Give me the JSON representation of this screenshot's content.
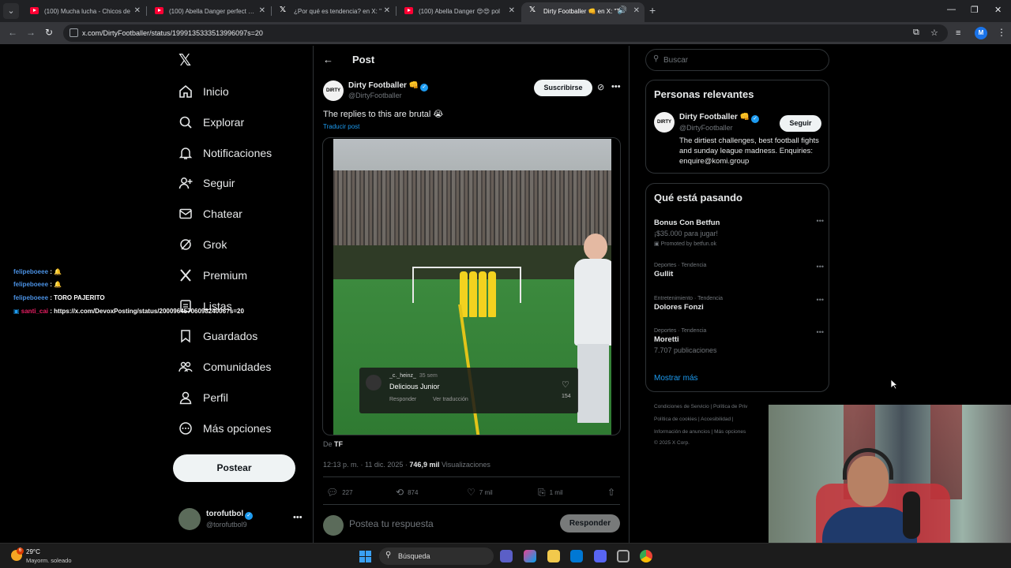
{
  "browser": {
    "tabs": [
      {
        "title": "(100) Mucha lucha - Chicos de",
        "favicon": "youtube-icon",
        "active": false
      },
      {
        "title": "(100) Abella Danger perfect ass",
        "favicon": "youtube-icon",
        "active": false
      },
      {
        "title": "¿Por qué es tendencia? en X: \"",
        "favicon": "x-icon",
        "active": false
      },
      {
        "title": "(100) Abella Danger 😍😍 pol",
        "favicon": "youtube-icon",
        "active": false
      },
      {
        "title": "Dirty Footballer 👊 en X: \"T",
        "favicon": "x-icon",
        "active": true
      }
    ],
    "url": "x.com/DirtyFootballer/status/1999135333513996097s=20",
    "profile_initial": "M"
  },
  "x": {
    "logo": "𝕏",
    "nav": [
      {
        "label": "Inicio",
        "icon": "home-icon"
      },
      {
        "label": "Explorar",
        "icon": "search-icon"
      },
      {
        "label": "Notificaciones",
        "icon": "bell-icon"
      },
      {
        "label": "Seguir",
        "icon": "person-add-icon"
      },
      {
        "label": "Chatear",
        "icon": "mail-icon"
      },
      {
        "label": "Grok",
        "icon": "grok-icon"
      },
      {
        "label": "Premium",
        "icon": "x-icon"
      },
      {
        "label": "Listas",
        "icon": "list-icon"
      },
      {
        "label": "Guardados",
        "icon": "bookmark-icon"
      },
      {
        "label": "Comunidades",
        "icon": "communities-icon"
      },
      {
        "label": "Perfil",
        "icon": "profile-icon"
      },
      {
        "label": "Más opciones",
        "icon": "more-icon"
      }
    ],
    "post_button": "Postear",
    "me": {
      "name": "torofutbol",
      "handle": "@torofutbol9"
    }
  },
  "chat": [
    {
      "user": "felipeboeee",
      "message": "🔔",
      "user_color": "#4a90e2"
    },
    {
      "user": "felipeboeee",
      "message": "🔔",
      "user_color": "#4a90e2"
    },
    {
      "user": "felipeboeee",
      "message": "TORO PAJERITO",
      "user_color": "#4a90e2"
    },
    {
      "user": "santi_cai",
      "message": "https://x.com/DevoxPosting/status/2000964570609824006?s=20",
      "user_color": "#e91e63"
    }
  ],
  "post": {
    "header": "Post",
    "author_name": "Dirty Footballer",
    "author_emoji": "👊",
    "author_handle": "@DirtyFootballer",
    "avatar_text": "DIRTY",
    "subscribe": "Suscribirse",
    "text": "The replies to this are brutal 😭",
    "translate": "Traducir post",
    "video_comment": {
      "user": "_c._heinz_",
      "time": "35 sem",
      "text": "Delicious Junior",
      "reply": "Responder",
      "translate": "Ver traducción",
      "likes": "154"
    },
    "from_prefix": "De",
    "from_source": "TF",
    "timestamp": "12:13 p. m. · 11 dic. 2025 ·",
    "views_count": "746,9 mil",
    "views_label": "Visualizaciones",
    "actions": [
      {
        "icon": "reply-icon",
        "count": "227"
      },
      {
        "icon": "retweet-icon",
        "count": "874"
      },
      {
        "icon": "heart-icon",
        "count": "7 mil"
      },
      {
        "icon": "bookmark-icon",
        "count": "1 mil"
      },
      {
        "icon": "share-icon",
        "count": ""
      }
    ],
    "reply_placeholder": "Postea tu respuesta",
    "reply_button": "Responder"
  },
  "sidebar": {
    "search_placeholder": "Buscar",
    "relevant": {
      "title": "Personas relevantes",
      "name": "Dirty Footballer",
      "emoji": "👊",
      "handle": "@DirtyFootballer",
      "follow": "Seguir",
      "bio": "The dirtiest challenges, best football fights and sunday league madness. Enquiries: enquire@komi.group"
    },
    "trending": {
      "title": "Qué está pasando",
      "items": [
        {
          "meta": "",
          "name": "Bonus Con Betfun",
          "sub": "¡$35.000 para jugar!",
          "promo": "Promoted by betfun.ok"
        },
        {
          "meta": "Deportes · Tendencia",
          "name": "Gullit",
          "sub": "",
          "promo": ""
        },
        {
          "meta": "Entretenimiento · Tendencia",
          "name": "Dolores Fonzi",
          "sub": "",
          "promo": ""
        },
        {
          "meta": "Deportes · Tendencia",
          "name": "Moretti",
          "sub": "7.707 publicaciones",
          "promo": ""
        }
      ],
      "show_more": "Mostrar más"
    },
    "footer": [
      "Condiciones de Servicio  |  Política de Priv",
      "Política de cookies  |  Accesibilidad  |",
      "Información de anuncios  |  Más opciones",
      "© 2025 X Corp."
    ]
  },
  "taskbar": {
    "weather_badge": "6",
    "temp": "29°C",
    "weather": "Mayorm. soleado",
    "search_placeholder": "Búsqueda"
  }
}
